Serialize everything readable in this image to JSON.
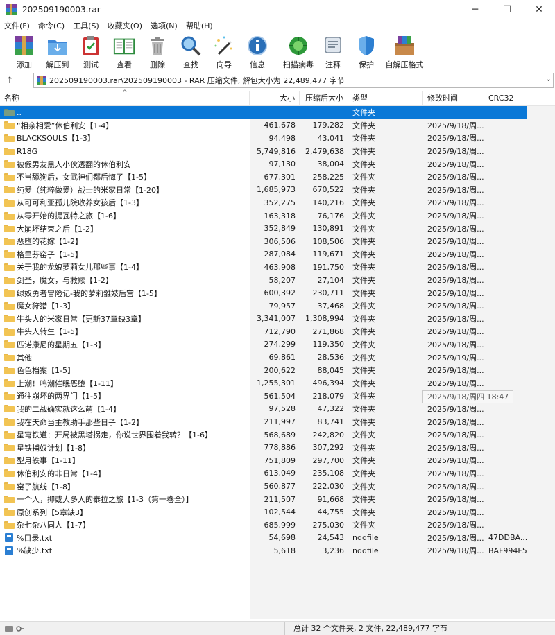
{
  "window": {
    "title": "202509190003.rar",
    "controls": {
      "minimize": "─",
      "maximize": "☐",
      "close": "✕"
    }
  },
  "menu": [
    "文件(F)",
    "命令(C)",
    "工具(S)",
    "收藏夹(O)",
    "选项(N)",
    "帮助(H)"
  ],
  "toolbar": [
    {
      "label": "添加",
      "icon": "add-archive-icon"
    },
    {
      "label": "解压到",
      "icon": "extract-folder-icon"
    },
    {
      "label": "测试",
      "icon": "test-clipboard-icon"
    },
    {
      "label": "查看",
      "icon": "view-book-icon"
    },
    {
      "label": "删除",
      "icon": "trash-icon"
    },
    {
      "label": "查找",
      "icon": "magnifier-icon"
    },
    {
      "label": "向导",
      "icon": "wizard-wand-icon"
    },
    {
      "label": "信息",
      "icon": "info-icon"
    },
    {
      "label": "扫描病毒",
      "icon": "virus-scan-icon"
    },
    {
      "label": "注释",
      "icon": "comment-icon"
    },
    {
      "label": "保护",
      "icon": "shield-icon"
    },
    {
      "label": "自解压格式",
      "icon": "sfx-box-icon"
    }
  ],
  "address": {
    "path": "202509190003.rar\\202509190003 - RAR 压缩文件, 解包大小为 22,489,477 字节"
  },
  "columns": {
    "name": "名称",
    "size": "大小",
    "packed": "压缩后大小",
    "type": "类型",
    "modified": "修改时间",
    "crc": "CRC32"
  },
  "files": [
    {
      "name": "..",
      "size": "",
      "packed": "",
      "type": "文件夹",
      "modified": "",
      "crc": "",
      "kind": "up",
      "selected": true
    },
    {
      "name": "“相亲相爱”休伯利安【1-4】",
      "size": "461,678",
      "packed": "179,282",
      "type": "文件夹",
      "modified": "2025/9/18/周...",
      "crc": "",
      "kind": "folder"
    },
    {
      "name": "BLACKSOULS【1-3】",
      "size": "94,498",
      "packed": "43,041",
      "type": "文件夹",
      "modified": "2025/9/18/周...",
      "crc": "",
      "kind": "folder"
    },
    {
      "name": "R18G",
      "size": "5,749,816",
      "packed": "2,479,638",
      "type": "文件夹",
      "modified": "2025/9/18/周...",
      "crc": "",
      "kind": "folder"
    },
    {
      "name": "被假男友黑人小伙透翻的休伯利安",
      "size": "97,130",
      "packed": "38,004",
      "type": "文件夹",
      "modified": "2025/9/18/周...",
      "crc": "",
      "kind": "folder"
    },
    {
      "name": "不当舔狗后，女武神们都后悔了【1-5】",
      "size": "677,301",
      "packed": "258,225",
      "type": "文件夹",
      "modified": "2025/9/18/周...",
      "crc": "",
      "kind": "folder"
    },
    {
      "name": "纯爱（纯粹做爱）战士的米家日常【1-20】",
      "size": "1,685,973",
      "packed": "670,522",
      "type": "文件夹",
      "modified": "2025/9/18/周...",
      "crc": "",
      "kind": "folder"
    },
    {
      "name": "从可可利亚孤儿院收养女孩后【1-3】",
      "size": "352,275",
      "packed": "140,216",
      "type": "文件夹",
      "modified": "2025/9/18/周...",
      "crc": "",
      "kind": "folder"
    },
    {
      "name": "从零开始的提瓦特之旅【1-6】",
      "size": "163,318",
      "packed": "76,176",
      "type": "文件夹",
      "modified": "2025/9/18/周...",
      "crc": "",
      "kind": "folder"
    },
    {
      "name": "大崩坏结束之后【1-2】",
      "size": "352,849",
      "packed": "130,891",
      "type": "文件夹",
      "modified": "2025/9/18/周...",
      "crc": "",
      "kind": "folder"
    },
    {
      "name": "恶堕的花嫁【1-2】",
      "size": "306,506",
      "packed": "108,506",
      "type": "文件夹",
      "modified": "2025/9/18/周...",
      "crc": "",
      "kind": "folder"
    },
    {
      "name": "格里芬窑子【1-5】",
      "size": "287,084",
      "packed": "119,671",
      "type": "文件夹",
      "modified": "2025/9/18/周...",
      "crc": "",
      "kind": "folder"
    },
    {
      "name": "关于我的龙娘萝莉女儿那些事【1-4】",
      "size": "463,908",
      "packed": "191,750",
      "type": "文件夹",
      "modified": "2025/9/18/周...",
      "crc": "",
      "kind": "folder"
    },
    {
      "name": "剑圣，魔女，与救赎【1-2】",
      "size": "58,207",
      "packed": "27,104",
      "type": "文件夹",
      "modified": "2025/9/18/周...",
      "crc": "",
      "kind": "folder"
    },
    {
      "name": "绿奴勇者冒险记-我的萝莉雏妓后宫【1-5】",
      "size": "600,392",
      "packed": "230,711",
      "type": "文件夹",
      "modified": "2025/9/18/周...",
      "crc": "",
      "kind": "folder"
    },
    {
      "name": "魔女狩猎【1-3】",
      "size": "79,957",
      "packed": "37,468",
      "type": "文件夹",
      "modified": "2025/9/18/周...",
      "crc": "",
      "kind": "folder"
    },
    {
      "name": "牛头人的米家日常【更新37章缺3章】",
      "size": "3,341,007",
      "packed": "1,308,994",
      "type": "文件夹",
      "modified": "2025/9/18/周...",
      "crc": "",
      "kind": "folder"
    },
    {
      "name": "牛头人转生【1-5】",
      "size": "712,790",
      "packed": "271,868",
      "type": "文件夹",
      "modified": "2025/9/18/周...",
      "crc": "",
      "kind": "folder"
    },
    {
      "name": "匹诺康尼的星期五【1-3】",
      "size": "274,299",
      "packed": "119,350",
      "type": "文件夹",
      "modified": "2025/9/18/周...",
      "crc": "",
      "kind": "folder"
    },
    {
      "name": "其他",
      "size": "69,861",
      "packed": "28,536",
      "type": "文件夹",
      "modified": "2025/9/19/周...",
      "crc": "",
      "kind": "folder"
    },
    {
      "name": "色色档案【1-5】",
      "size": "200,622",
      "packed": "88,045",
      "type": "文件夹",
      "modified": "2025/9/18/周...",
      "crc": "",
      "kind": "folder"
    },
    {
      "name": "上潮！鸣潮催眠恶堕【1-11】",
      "size": "1,255,301",
      "packed": "496,394",
      "type": "文件夹",
      "modified": "2025/9/18/周...",
      "crc": "",
      "kind": "folder"
    },
    {
      "name": "通往崩坏的两界门【1-5】",
      "size": "561,504",
      "packed": "218,079",
      "type": "文件夹",
      "modified": "",
      "crc": "",
      "kind": "folder"
    },
    {
      "name": "我的二战确实就这么萌【1-4】",
      "size": "97,528",
      "packed": "47,322",
      "type": "文件夹",
      "modified": "2025/9/18/周...",
      "crc": "",
      "kind": "folder"
    },
    {
      "name": "我在天命当主教助手那些日子【1-2】",
      "size": "211,997",
      "packed": "83,741",
      "type": "文件夹",
      "modified": "2025/9/18/周...",
      "crc": "",
      "kind": "folder"
    },
    {
      "name": "星穹铁道：开局被黑塔拐走，你说世界围着我转？【1-6】",
      "size": "568,689",
      "packed": "242,820",
      "type": "文件夹",
      "modified": "2025/9/18/周...",
      "crc": "",
      "kind": "folder"
    },
    {
      "name": "星铁捕奴计划【1-8】",
      "size": "778,886",
      "packed": "307,292",
      "type": "文件夹",
      "modified": "2025/9/18/周...",
      "crc": "",
      "kind": "folder"
    },
    {
      "name": "型月轶事【1-11】",
      "size": "751,809",
      "packed": "297,700",
      "type": "文件夹",
      "modified": "2025/9/18/周...",
      "crc": "",
      "kind": "folder"
    },
    {
      "name": "休伯利安的非日常【1-4】",
      "size": "613,049",
      "packed": "235,108",
      "type": "文件夹",
      "modified": "2025/9/18/周...",
      "crc": "",
      "kind": "folder"
    },
    {
      "name": "窑子航线【1-8】",
      "size": "560,877",
      "packed": "222,030",
      "type": "文件夹",
      "modified": "2025/9/18/周...",
      "crc": "",
      "kind": "folder"
    },
    {
      "name": "一个人，抑或大多人的泰拉之旅【1-3（第一卷全）】",
      "size": "211,507",
      "packed": "91,668",
      "type": "文件夹",
      "modified": "2025/9/18/周...",
      "crc": "",
      "kind": "folder"
    },
    {
      "name": "原创系列【5章缺3】",
      "size": "102,544",
      "packed": "44,755",
      "type": "文件夹",
      "modified": "2025/9/18/周...",
      "crc": "",
      "kind": "folder"
    },
    {
      "name": "杂七杂八同人【1-7】",
      "size": "685,999",
      "packed": "275,030",
      "type": "文件夹",
      "modified": "2025/9/18/周...",
      "crc": "",
      "kind": "folder"
    },
    {
      "name": "%目录.txt",
      "size": "54,698",
      "packed": "24,543",
      "type": "nddfile",
      "modified": "2025/9/18/周...",
      "crc": "47DDBA...",
      "kind": "file"
    },
    {
      "name": "%缺少.txt",
      "size": "5,618",
      "packed": "3,236",
      "type": "nddfile",
      "modified": "2025/9/18/周...",
      "crc": "BAF994F5",
      "kind": "file"
    }
  ],
  "tooltip": "2025/9/18/周四 18:47",
  "status": "总计 32 个文件夹, 2 文件, 22,489,477 字节",
  "colors": {
    "selection": "#0a78d7",
    "folder": "#f2c453",
    "column_shade": "#f3f3f3"
  }
}
